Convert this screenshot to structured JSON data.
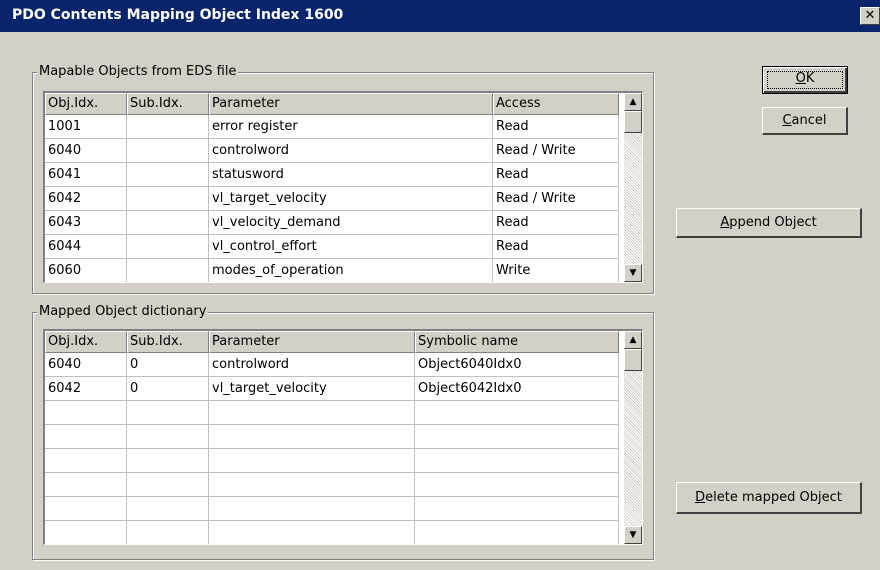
{
  "window": {
    "title": "PDO Contents Mapping Object Index 1600",
    "close_glyph": "✕"
  },
  "mapable": {
    "legend": "Mapable Objects from EDS file",
    "columns": [
      "Obj.Idx.",
      "Sub.Idx.",
      "Parameter",
      "Access"
    ],
    "rows": [
      [
        "1001",
        "",
        "error register",
        "Read"
      ],
      [
        "6040",
        "",
        "controlword",
        "Read / Write"
      ],
      [
        "6041",
        "",
        "statusword",
        "Read"
      ],
      [
        "6042",
        "",
        "vl_target_velocity",
        "Read / Write"
      ],
      [
        "6043",
        "",
        "vl_velocity_demand",
        "Read"
      ],
      [
        "6044",
        "",
        "vl_control_effort",
        "Read"
      ],
      [
        "6060",
        "",
        "modes_of_operation",
        "Write"
      ]
    ]
  },
  "mapped": {
    "legend": "Mapped Object dictionary",
    "columns": [
      "Obj.Idx.",
      "Sub.Idx.",
      "Parameter",
      "Symbolic name"
    ],
    "rows": [
      [
        "6040",
        "0",
        "controlword",
        "Object6040Idx0"
      ],
      [
        "6042",
        "0",
        "vl_target_velocity",
        "Object6042Idx0"
      ],
      [
        "",
        "",
        "",
        ""
      ],
      [
        "",
        "",
        "",
        ""
      ],
      [
        "",
        "",
        "",
        ""
      ],
      [
        "",
        "",
        "",
        ""
      ],
      [
        "",
        "",
        "",
        ""
      ],
      [
        "",
        "",
        "",
        ""
      ]
    ]
  },
  "buttons": {
    "ok": {
      "mnemonic": "O",
      "rest": "K"
    },
    "cancel": {
      "mnemonic": "C",
      "rest": "ancel"
    },
    "append": {
      "mnemonic": "A",
      "rest": "ppend Object"
    },
    "delete": {
      "mnemonic": "D",
      "rest": "elete mapped Object"
    }
  },
  "icons": {
    "scroll_up": "scroll-up-arrow",
    "scroll_down": "scroll-down-arrow",
    "close": "close-x"
  }
}
